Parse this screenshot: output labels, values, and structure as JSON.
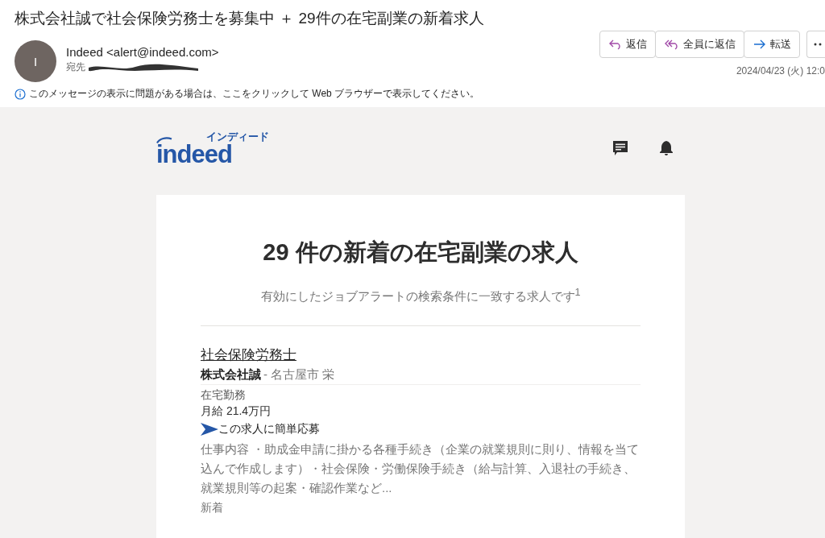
{
  "email": {
    "subject": "株式会社誠で社会保険労務士を募集中 ＋ 29件の在宅副業の新着求人",
    "sender": "Indeed <alert@indeed.com>",
    "avatar_initial": "I",
    "to_label": "宛先",
    "date": "2024/04/23 (火) 12:0",
    "notice": "このメッセージの表示に問題がある場合は、ここをクリックして Web ブラウザーで表示してください。",
    "actions": [
      {
        "kind": "reply",
        "label": "返信"
      },
      {
        "kind": "reply_all",
        "label": "全員に返信"
      },
      {
        "kind": "forward",
        "label": "転送"
      }
    ]
  },
  "body": {
    "logo": {
      "word": "indeed",
      "kana": "インディード"
    },
    "heading": "29 件の新着の在宅副業の求人",
    "subheading": "有効にしたジョブアラートの検索条件に一致する求人です$^{1}$",
    "jobs": [
      {
        "title": "社会保険労務士",
        "company": "株式会社誠",
        "location": "- 名古屋市 栄",
        "work_style": "在宅勤務",
        "salary": "月給 21.4万円",
        "easy_apply": "この求人に簡単応募",
        "description": "仕事内容 ・助成金申請に掛かる各種手続き（企業の就業規則に則り、情報を当て込んで作成します）・社会保険・労働保険手続き（給与計算、入退社の手続き、就業規則等の起案・確認作業など...",
        "tag": "新着"
      }
    ]
  }
}
